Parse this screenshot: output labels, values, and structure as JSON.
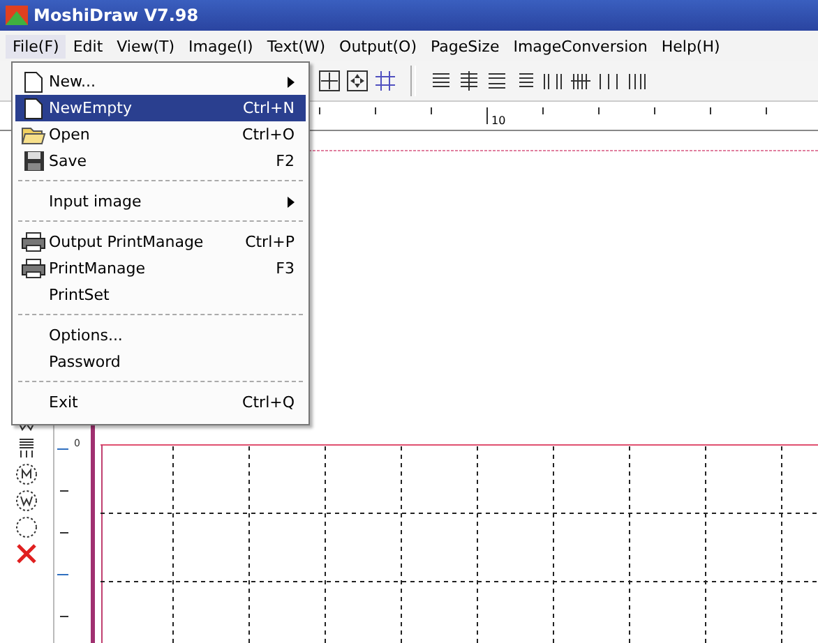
{
  "window": {
    "title": "MoshiDraw V7.98"
  },
  "menu_bar": [
    {
      "label": "File(F)",
      "selected": true
    },
    {
      "label": "Edit",
      "selected": false
    },
    {
      "label": "View(T)",
      "selected": false
    },
    {
      "label": "Image(I)",
      "selected": false
    },
    {
      "label": "Text(W)",
      "selected": false
    },
    {
      "label": "Output(O)",
      "selected": false
    },
    {
      "label": "PageSize",
      "selected": false
    },
    {
      "label": "ImageConversion",
      "selected": false
    },
    {
      "label": "Help(H)",
      "selected": false
    }
  ],
  "file_menu": [
    {
      "kind": "item",
      "label": "New...",
      "submenu": true,
      "selected": false
    },
    {
      "kind": "item",
      "label": "NewEmpty",
      "shortcut": "Ctrl+N",
      "selected": true
    },
    {
      "kind": "item",
      "label": "Open",
      "shortcut": "Ctrl+O",
      "selected": false
    },
    {
      "kind": "item",
      "label": "Save",
      "shortcut": "F2",
      "selected": false
    },
    {
      "kind": "separator"
    },
    {
      "kind": "item",
      "label": "Input image",
      "submenu": true,
      "selected": false
    },
    {
      "kind": "separator"
    },
    {
      "kind": "item",
      "label": "Output PrintManage",
      "shortcut": "Ctrl+P",
      "selected": false
    },
    {
      "kind": "item",
      "label": "PrintManage",
      "shortcut": "F3",
      "selected": false
    },
    {
      "kind": "item",
      "label": "PrintSet",
      "selected": false
    },
    {
      "kind": "separator"
    },
    {
      "kind": "item",
      "label": "Options...",
      "selected": false
    },
    {
      "kind": "item",
      "label": "Password",
      "selected": false
    },
    {
      "kind": "separator"
    },
    {
      "kind": "item",
      "label": "Exit",
      "shortcut": "Ctrl+Q",
      "selected": false
    }
  ],
  "horizontal_ruler": {
    "label": "10"
  },
  "vertical_ruler": {
    "label": "0"
  }
}
